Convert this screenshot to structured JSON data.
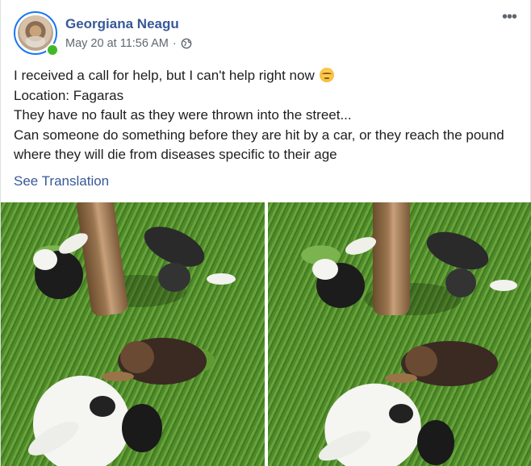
{
  "post": {
    "author": "Georgiana Neagu",
    "timestamp": "May 20 at 11:56 AM",
    "separator": "·",
    "privacy_icon": "globe-icon",
    "more_icon": "more-horizontal-icon",
    "online": true,
    "body_lines": [
      "I received a call for help, but I can't help right now",
      "Location: Fagaras",
      "They have no fault as they were thrown into the street...",
      "Can someone do something before they are hit by a car, or they reach the pound where they will die from diseases specific to their age"
    ],
    "emoji": "disappointed-face",
    "see_translation": "See Translation",
    "photos": [
      "puppies-under-tree-left",
      "puppies-under-tree-right"
    ]
  },
  "colors": {
    "author_link": "#385898",
    "meta_text": "#616770",
    "online_dot": "#42b72a",
    "avatar_ring": "#1877f2"
  }
}
